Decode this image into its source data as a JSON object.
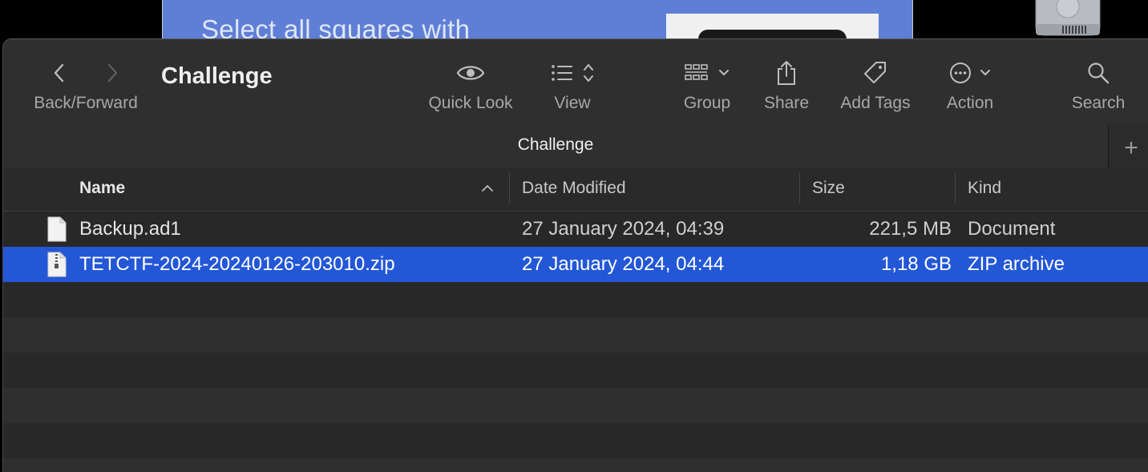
{
  "background": {
    "captcha_text": "Select all squares with"
  },
  "window": {
    "title": "Challenge",
    "tab_title": "Challenge",
    "tab_add": "+"
  },
  "toolbar": {
    "back_forward_label": "Back/Forward",
    "quick_look_label": "Quick Look",
    "view_label": "View",
    "group_label": "Group",
    "share_label": "Share",
    "add_tags_label": "Add Tags",
    "action_label": "Action",
    "search_label": "Search"
  },
  "columns": {
    "name": "Name",
    "date_modified": "Date Modified",
    "size": "Size",
    "kind": "Kind",
    "sort": "ascending"
  },
  "files": [
    {
      "name": "Backup.ad1",
      "date": "27 January 2024, 04:39",
      "size": "221,5 MB",
      "kind": "Document",
      "selected": false
    },
    {
      "name": "TETCTF-2024-20240126-203010.zip",
      "date": "27 January 2024, 04:44",
      "size": "1,18 GB",
      "kind": "ZIP archive",
      "selected": true
    }
  ],
  "colors": {
    "selection": "#2357d6",
    "window_bg": "#282828",
    "toolbar_bg": "#2f2f2f"
  }
}
